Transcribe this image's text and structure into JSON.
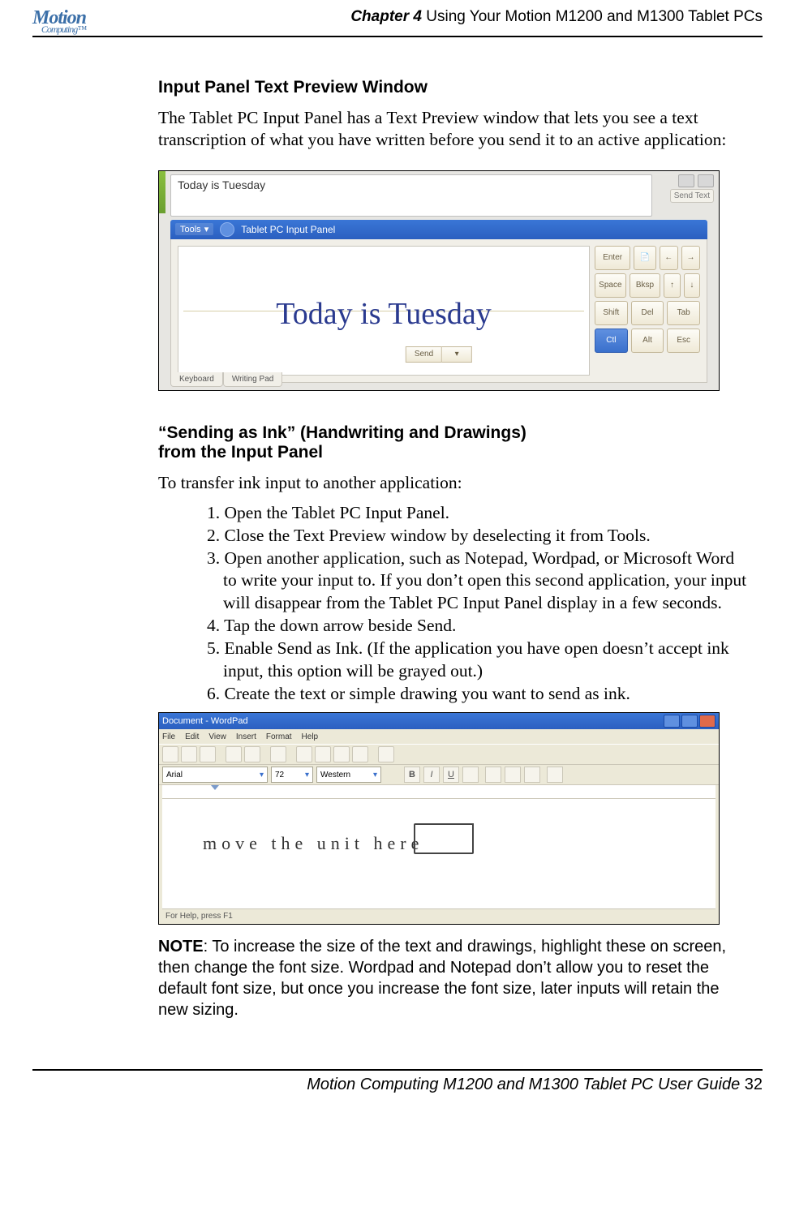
{
  "header": {
    "logo_main": "Motion",
    "logo_sub": "Computing™",
    "chapter_bold": "Chapter 4",
    "chapter_rest": " Using Your Motion M1200 and M1300 Tablet PCs"
  },
  "section1": {
    "heading": "Input Panel Text Preview Window",
    "intro": "The Tablet PC Input Panel has a Text Preview window that lets you see a text transcription of what you have written before you send it to an active application:"
  },
  "shot1": {
    "preview_text": "Today is Tuesday",
    "send_text": "Send Text",
    "tools_label": "Tools",
    "title": "Tablet PC Input Panel",
    "handwriting": "Today is Tuesday",
    "keys": {
      "enter": "Enter",
      "space": "Space",
      "shift": "Shift",
      "ctl": "Ctl",
      "bksp": "Bksp",
      "del": "Del",
      "alt": "Alt",
      "tab": "Tab",
      "esc": "Esc",
      "left": "←",
      "right": "→",
      "up": "↑",
      "down": "↓",
      "doc": "📄"
    },
    "send_button": "Send",
    "tab_keyboard": "Keyboard",
    "tab_writing": "Writing Pad"
  },
  "section2": {
    "heading_l1": "“Sending as Ink” (Handwriting and Drawings)",
    "heading_l2": "from the Input Panel",
    "intro": "To transfer ink input to another application:",
    "steps": [
      "1. Open the Tablet PC Input Panel.",
      "2. Close the Text Preview window by deselecting it from Tools.",
      "3. Open another application, such as Notepad, Wordpad, or Microsoft Word to write your input to. If you don’t open this second application, your input will disappear from the Tablet PC Input Panel display in a few seconds.",
      "4. Tap the down arrow beside Send.",
      "5. Enable Send as Ink. (If the application you have open doesn’t accept ink input, this option will be grayed out.)",
      "6. Create the text or simple drawing you want to send as ink."
    ]
  },
  "shot2": {
    "title": "Document - WordPad",
    "menus": [
      "File",
      "Edit",
      "View",
      "Insert",
      "Format",
      "Help"
    ],
    "font_name": "Arial",
    "font_size": "72",
    "script": "Western",
    "fmt": {
      "b": "B",
      "i": "I",
      "u": "U"
    },
    "handwriting": "move   the   unit   here",
    "status": "For Help, press F1"
  },
  "note": {
    "label": "NOTE",
    "text": ": To increase the size of the text and drawings, highlight these on screen, then change the font size. Wordpad and Notepad don’t allow you to reset the default font size, but once you increase the font size, later inputs will retain the new sizing."
  },
  "footer": {
    "text": "Motion Computing M1200 and M1300 Tablet PC User Guide ",
    "page": "32"
  }
}
